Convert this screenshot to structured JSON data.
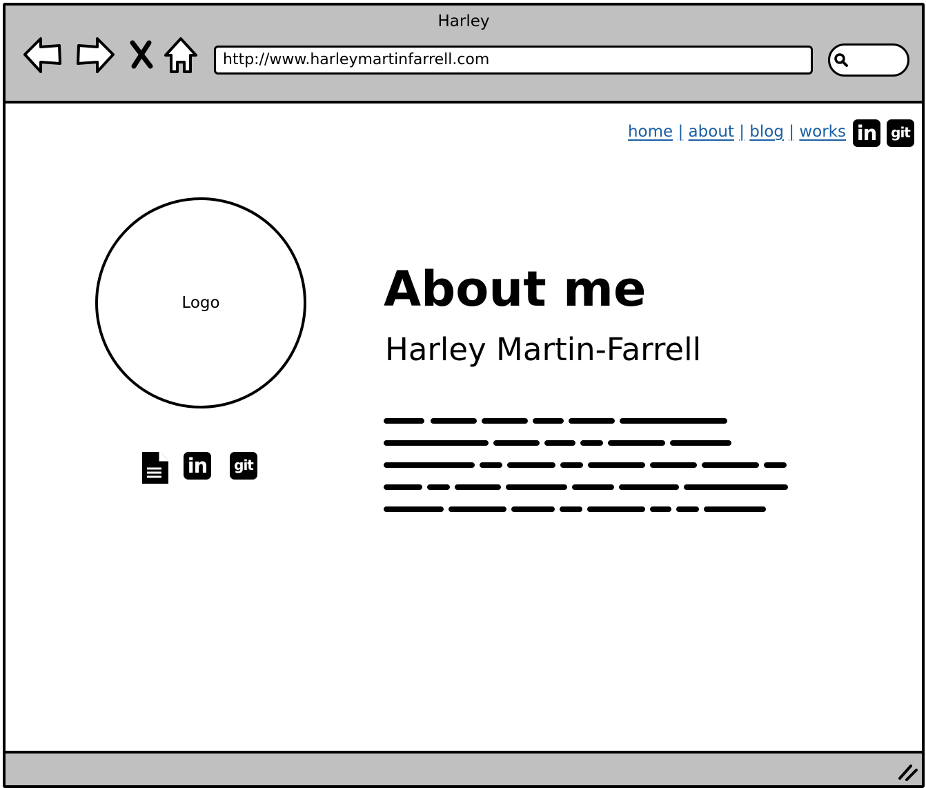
{
  "window": {
    "title": "Harley"
  },
  "toolbar": {
    "back_icon": "back-arrow-icon",
    "forward_icon": "forward-arrow-icon",
    "stop_icon": "close-x-icon",
    "home_icon": "home-icon",
    "address": "http://www.harleymartinfarrell.com",
    "search_icon": "search-icon",
    "search_value": ""
  },
  "top_nav": {
    "links": [
      {
        "label": "home"
      },
      {
        "label": "about"
      },
      {
        "label": "blog"
      },
      {
        "label": "works"
      }
    ],
    "separator": "|",
    "social": [
      {
        "icon": "linkedin-icon",
        "text": "in"
      },
      {
        "icon": "git-icon",
        "text": "git"
      }
    ]
  },
  "profile": {
    "logo_label": "Logo",
    "icons": [
      {
        "icon": "document-icon"
      },
      {
        "icon": "linkedin-icon",
        "text": "in"
      },
      {
        "icon": "git-icon",
        "text": "git"
      }
    ]
  },
  "about": {
    "heading": "About me",
    "name": "Harley Martin-Farrell"
  },
  "colors": {
    "chrome": "#c0c0c0",
    "link": "#1a5fa3",
    "ink": "#000000"
  }
}
